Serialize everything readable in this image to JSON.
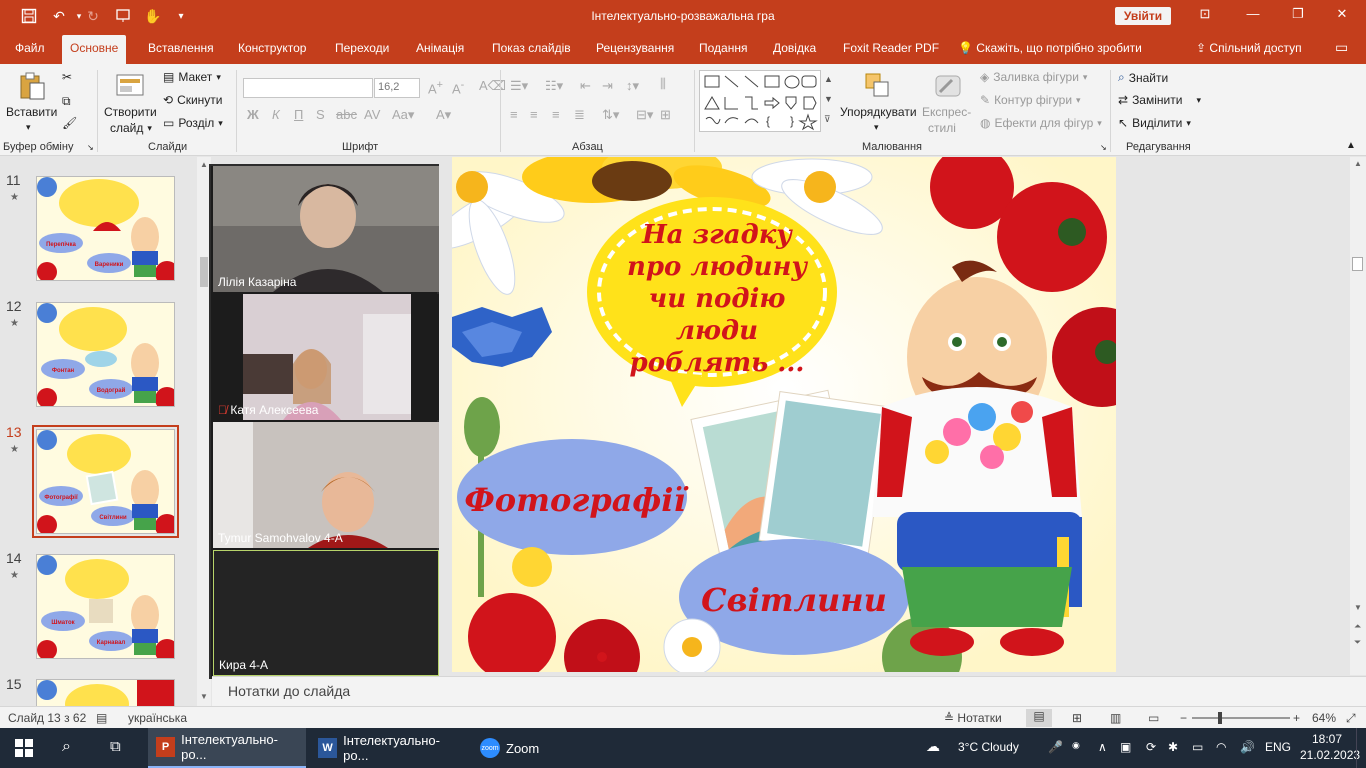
{
  "window": {
    "title": "Інтелектуально-розважальна гра",
    "signin_label": "Увійти"
  },
  "tabs": [
    "Файл",
    "Основне",
    "Вставлення",
    "Конструктор",
    "Переходи",
    "Анімація",
    "Показ слайдів",
    "Рецензування",
    "Подання",
    "Довідка",
    "Foxit Reader PDF"
  ],
  "tell_me": "Скажіть, що потрібно зробити",
  "share": "Спільний доступ",
  "ribbon": {
    "clipboard": {
      "paste": "Вставити",
      "label": "Буфер обміну"
    },
    "slides": {
      "new_slide_1": "Створити",
      "new_slide_2": "слайд",
      "layout": "Макет",
      "reset": "Скинути",
      "section": "Розділ",
      "label": "Слайди"
    },
    "font": {
      "name_value": "",
      "size_value": "16,2",
      "bold": "Ж",
      "italic": "К",
      "underline": "П",
      "label": "Шрифт"
    },
    "paragraph": {
      "label": "Абзац"
    },
    "drawing": {
      "arrange": "Упорядкувати",
      "quick_styles_1": "Експрес-",
      "quick_styles_2": "стилі",
      "fill": "Заливка фігури",
      "outline": "Контур фігури",
      "effects": "Ефекти для фігур",
      "label": "Малювання"
    },
    "editing": {
      "find": "Знайти",
      "replace": "Замінити",
      "select": "Виділити",
      "label": "Редагування"
    }
  },
  "thumbnails": [
    {
      "number": "11",
      "left": "Перепічка",
      "right": "Вареники"
    },
    {
      "number": "12",
      "left": "Фонтан",
      "right": "Водограй"
    },
    {
      "number": "13",
      "left": "Фотографії",
      "right": "Світлини"
    },
    {
      "number": "14",
      "left": "Шматок",
      "right": "Карнавал"
    },
    {
      "number": "15",
      "left": "",
      "right": ""
    }
  ],
  "zoom": {
    "participants": [
      {
        "name": "Лілія Казаріна",
        "muted": false
      },
      {
        "name": "Катя Алексеева",
        "muted": true
      },
      {
        "name": "Tymur Samohvalov 4-A",
        "muted": false
      },
      {
        "name": "Кира 4-А",
        "muted": false
      }
    ]
  },
  "slide": {
    "question": "На згадку про людину чи подію люди роблять ...",
    "option_left": "Фотографії",
    "option_right": "Світлини"
  },
  "notes_placeholder": "Нотатки до слайда",
  "status": {
    "slide_counter": "Слайд 13 з 62",
    "language": "українська",
    "notes_button": "Нотатки",
    "zoom_level": "64%"
  },
  "taskbar": {
    "apps": [
      "Інтелектуально-ро...",
      "Інтелектуально-ро...",
      "Zoom"
    ],
    "weather": "3°C  Cloudy",
    "lang": "ENG",
    "time": "18:07",
    "date": "21.02.2023"
  },
  "colors": {
    "accent": "#c43e1c",
    "slide_red": "#d1141b",
    "taskbar": "#1f2a38"
  }
}
